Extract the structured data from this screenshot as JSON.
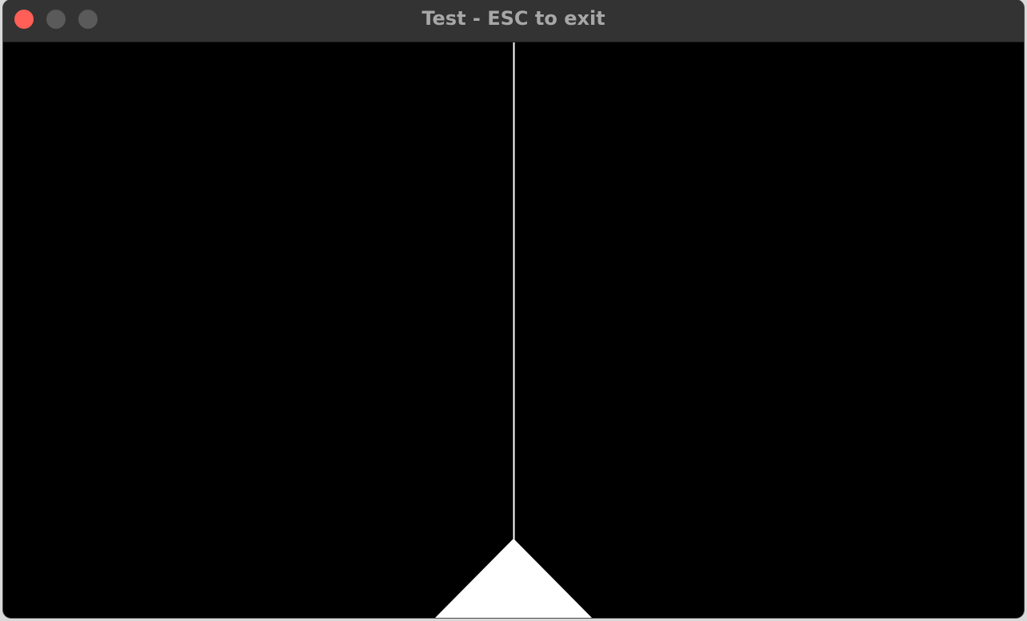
{
  "window": {
    "title": "Test - ESC to exit",
    "controls": {
      "close_color": "#ff5f57",
      "minimize_color": "#5a5a5a",
      "maximize_color": "#5a5a5a"
    }
  },
  "scene": {
    "background_color": "#000000",
    "ray_color": "#ffffff",
    "ship_color": "#ffffff",
    "ship_icon": "triangle-ship-icon",
    "ray_icon": "laser-beam-icon"
  }
}
